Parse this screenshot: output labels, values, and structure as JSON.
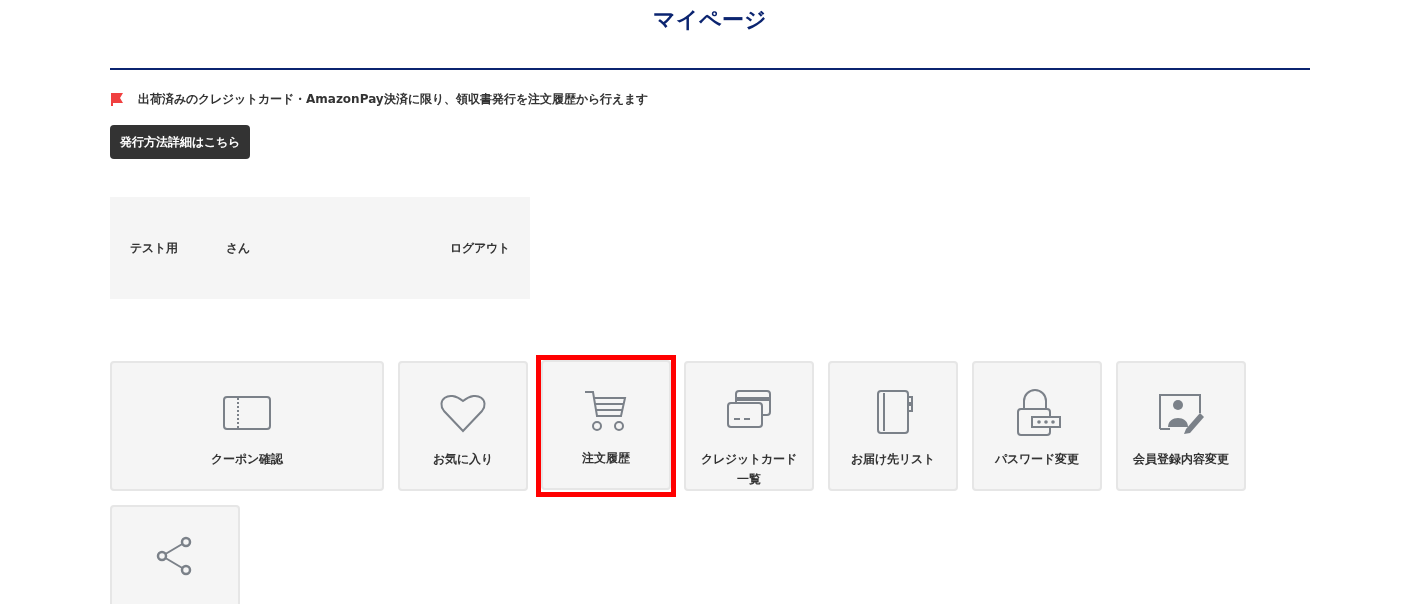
{
  "page_title": "マイページ",
  "notice": {
    "text": "出荷済みのクレジットカード・AmazonPay決済に限り、領収書発行を注文履歴から行えます",
    "button": "発行方法詳細はこちら"
  },
  "user": {
    "name": "テスト用",
    "suffix": "さん",
    "logout": "ログアウト"
  },
  "tiles": [
    {
      "kind": "coupon",
      "label": "クーポン確認",
      "wide": true,
      "highlighted": false
    },
    {
      "kind": "heart",
      "label": "お気に入り",
      "wide": false,
      "highlighted": false
    },
    {
      "kind": "cart",
      "label": "注文履歴",
      "wide": false,
      "highlighted": true
    },
    {
      "kind": "cards",
      "label": "クレジットカード一覧",
      "wide": false,
      "highlighted": false
    },
    {
      "kind": "notebook",
      "label": "お届け先リスト",
      "wide": false,
      "highlighted": false
    },
    {
      "kind": "lock",
      "label": "パスワード変更",
      "wide": false,
      "highlighted": false
    },
    {
      "kind": "profile",
      "label": "会員登録内容変更",
      "wide": false,
      "highlighted": false
    },
    {
      "kind": "share",
      "wide": false,
      "highlighted": false
    }
  ]
}
